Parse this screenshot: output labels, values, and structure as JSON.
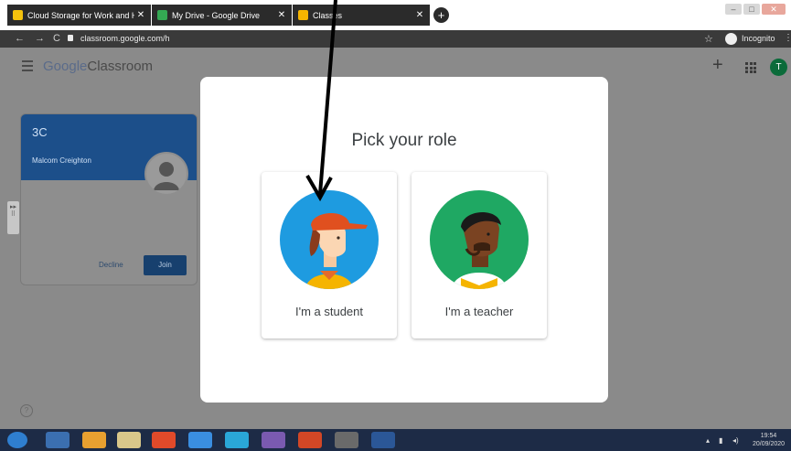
{
  "browser": {
    "tabs": [
      {
        "title": "Cloud Storage for Work and Hor",
        "favicon": "drive-icon"
      },
      {
        "title": "My Drive - Google Drive",
        "favicon": "drive-icon"
      },
      {
        "title": "Classes",
        "favicon": "classroom-icon",
        "active": true
      }
    ],
    "url": "classroom.google.com/h",
    "incognito_label": "Incognito"
  },
  "app": {
    "logo_google": "Google",
    "logo_product": "Classroom",
    "avatar_initial": "T"
  },
  "class_card": {
    "name": "3C",
    "teacher": "Malcom Creighton",
    "decline_label": "Decline",
    "join_label": "Join"
  },
  "dialog": {
    "title": "Pick your role",
    "roles": [
      {
        "label": "I'm a student"
      },
      {
        "label": "I'm a teacher"
      }
    ]
  },
  "taskbar": {
    "time": "19:54",
    "date": "20/09/2020"
  },
  "colors": {
    "accent_blue": "#1c4f8a",
    "student_bg": "#1e9be0",
    "teacher_bg": "#1fa863"
  }
}
